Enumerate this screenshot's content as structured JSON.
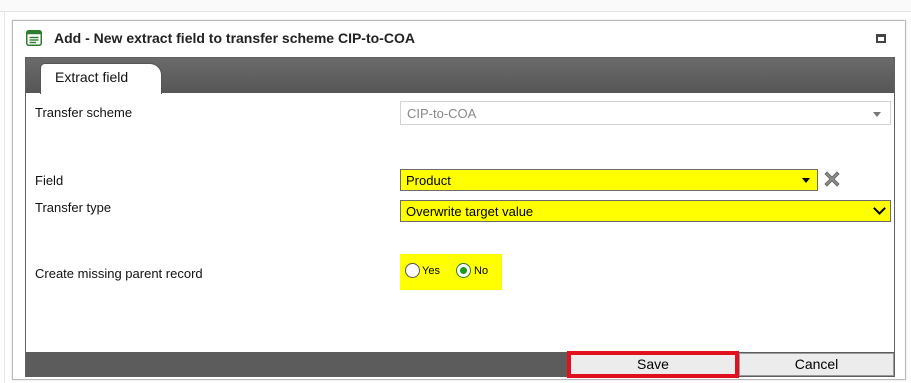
{
  "dialog": {
    "title": "Add - New extract field to transfer scheme CIP-to-COA"
  },
  "tabs": [
    {
      "label": "Extract field"
    }
  ],
  "form": {
    "transfer_scheme": {
      "label": "Transfer scheme",
      "value": "CIP-to-COA"
    },
    "field": {
      "label": "Field",
      "value": "Product"
    },
    "transfer_type": {
      "label": "Transfer type",
      "value": "Overwrite target value"
    },
    "create_missing_parent": {
      "label": "Create missing parent record",
      "options": [
        "Yes",
        "No"
      ],
      "selected": "No"
    }
  },
  "buttons": {
    "save": "Save",
    "cancel": "Cancel"
  },
  "colors": {
    "highlight": "#ffff00",
    "save_outline": "#e0101e",
    "tabstrip": "#5c5c5c"
  }
}
